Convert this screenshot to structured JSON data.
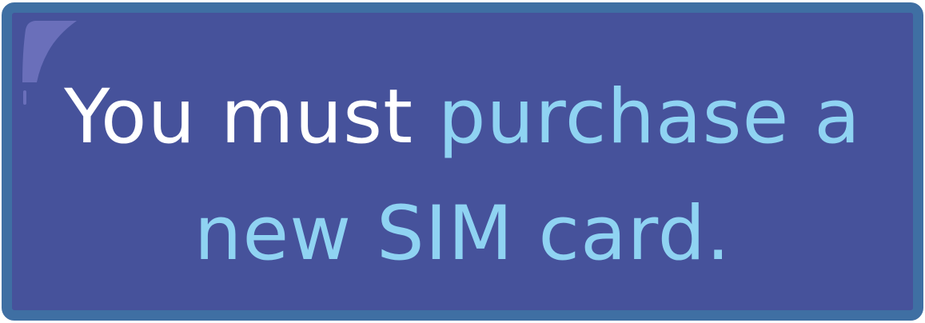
{
  "notice": {
    "line1_plain": "You must ",
    "line1_accent": "purchase a",
    "line2_accent": "new SIM card."
  },
  "colors": {
    "background": "#46529b",
    "border": "#3f6fa3",
    "text_plain": "#ffffff",
    "text_accent": "#8fd3f2"
  }
}
